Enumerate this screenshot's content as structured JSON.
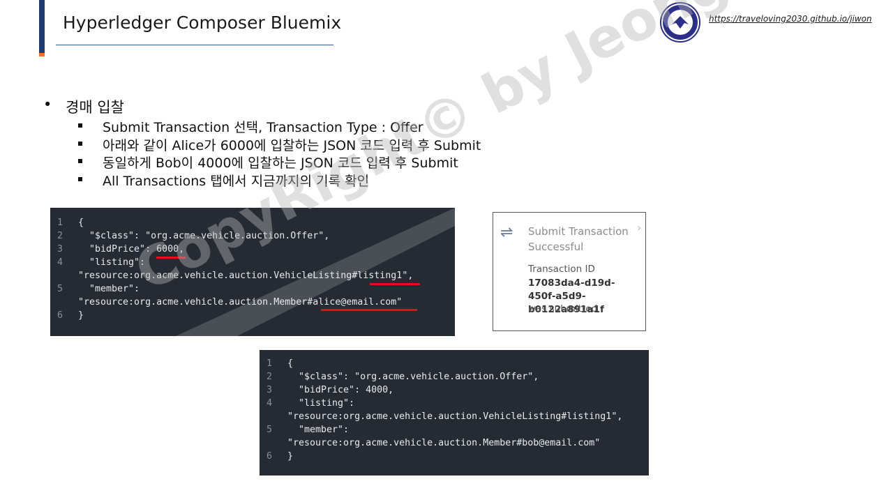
{
  "header": {
    "title": "Hyperledger Composer Bluemix",
    "url": "https://traveloving2030.github.io/jiwon",
    "accent_color": "#1f3a6e",
    "accent_secondary": "#e8742a"
  },
  "bullets": {
    "main": "경매 입찰",
    "sub": [
      "Submit Transaction 선택, Transaction Type : Offer",
      "아래와 같이 Alice가 6000에 입찰하는 JSON 코드 입력 후 Submit",
      "동일하게 Bob이 4000에 입찰하는 JSON 코드 입력 후 Submit",
      "All Transactions 탭에서 지금까지의 기록 확인"
    ]
  },
  "code_alice": {
    "line_numbers": [
      "1",
      "2",
      "3",
      "4",
      "5",
      "6"
    ],
    "lines": [
      "{",
      "  \"$class\": \"org.acme.vehicle.auction.Offer\",",
      "  \"bidPrice\": 6000,",
      "  \"listing\":",
      "\"resource:org.acme.vehicle.auction.VehicleListing#listing1\",",
      "  \"member\":",
      "\"resource:org.acme.vehicle.auction.Member#alice@email.com\"",
      "}"
    ]
  },
  "code_bob": {
    "line_numbers": [
      "1",
      "2",
      "3",
      "4",
      "5",
      "6"
    ],
    "lines": [
      "{",
      "  \"$class\": \"org.acme.vehicle.auction.Offer\",",
      "  \"bidPrice\": 4000,",
      "  \"listing\":",
      "\"resource:org.acme.vehicle.auction.VehicleListing#listing1\",",
      "  \"member\":",
      "\"resource:org.acme.vehicle.auction.Member#bob@email.com\"",
      "}"
    ]
  },
  "toast": {
    "icon": "transfer-arrows-icon",
    "title": "Submit Transaction Successful",
    "id_label": "Transaction ID",
    "id_value": "17083da4-d19d-450f-a5d9-b0122a891a1f",
    "footer": "was submitted"
  },
  "watermark": "CopyRight© by Jeong JiWon",
  "highlight_color": "#e0101a"
}
